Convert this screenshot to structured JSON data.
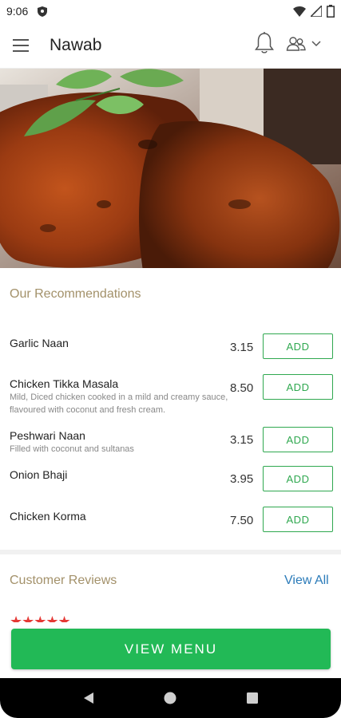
{
  "status_bar": {
    "time": "9:06"
  },
  "app_bar": {
    "title": "Nawab"
  },
  "recommendations": {
    "title": "Our Recommendations",
    "add_label": "ADD",
    "items": [
      {
        "name": "Garlic Naan",
        "description": "",
        "price": "3.15"
      },
      {
        "name": "Chicken Tikka Masala",
        "description": "Mild, Diced chicken cooked in a mild and creamy sauce, flavoured with coconut and fresh cream.",
        "price": "8.50"
      },
      {
        "name": "Peshwari Naan",
        "description": "Filled with coconut and sultanas",
        "price": "3.15"
      },
      {
        "name": "Onion Bhaji",
        "description": "",
        "price": "3.95"
      },
      {
        "name": "Chicken Korma",
        "description": "",
        "price": "7.50"
      }
    ]
  },
  "reviews": {
    "title": "Customer Reviews",
    "view_all": "View All",
    "first_review_rating": 5
  },
  "cta": {
    "view_menu": "VIEW MENU"
  },
  "colors": {
    "accent_green": "#22b956",
    "section_title": "#a3916a",
    "link_blue": "#2b7bb9",
    "star_red": "#e53935"
  }
}
